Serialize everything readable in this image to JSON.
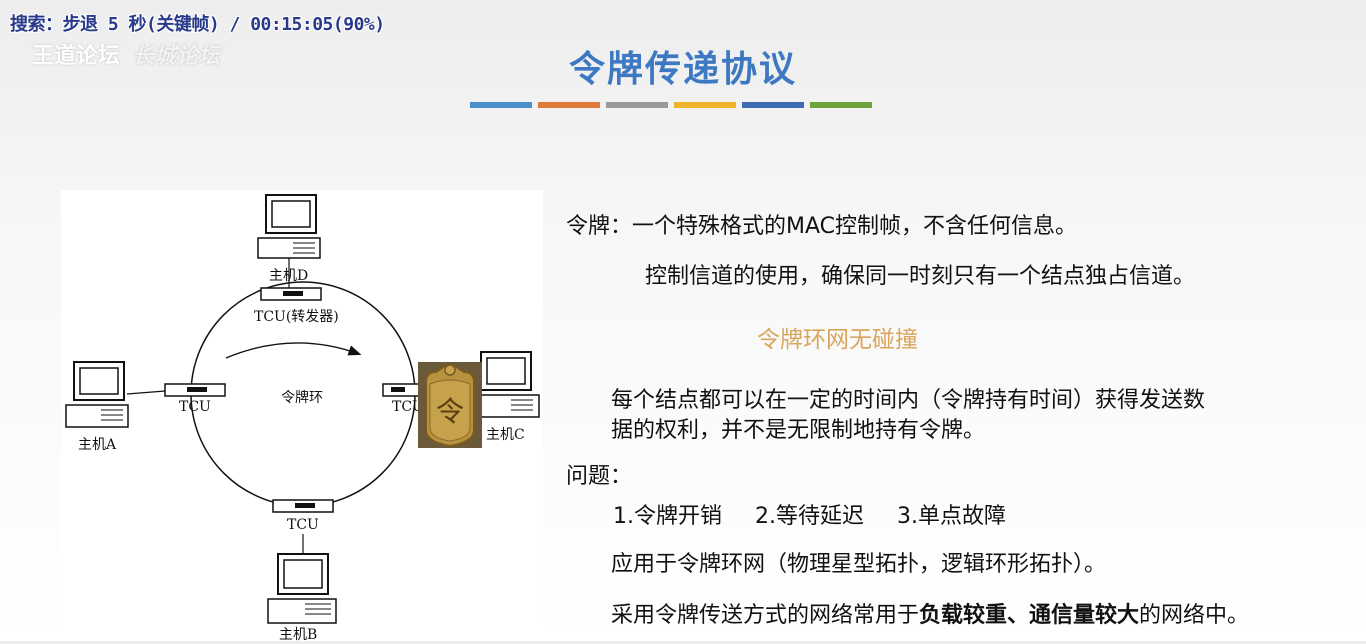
{
  "overlay": {
    "status_text": "搜索：步退 5 秒(关键帧) / 00:15:05(90%)"
  },
  "watermark": {
    "text": "王道论坛",
    "faint_text": "长城论坛"
  },
  "slide": {
    "title": "令牌传递协议",
    "title_color": "#3d78c2",
    "bar_colors": [
      "#4a8fc9",
      "#e07a3a",
      "#9a9a9a",
      "#f0b42a",
      "#3f6bb5",
      "#6ea33c"
    ]
  },
  "diagram": {
    "host_d": "主机D",
    "tcu_top": "TCU(转发器)",
    "host_a": "主机A",
    "tcu_left": "TCU",
    "ring": "令牌环",
    "tcu_right": "TCU",
    "host_c": "主机C",
    "tcu_bottom": "TCU",
    "host_b": "主机B",
    "token_char": "令"
  },
  "content": {
    "line1": "令牌：一个特殊格式的MAC控制帧，不含任何信息。",
    "line2": "控制信道的使用，确保同一时刻只有一个结点独占信道。",
    "highlight": "令牌环网无碰撞",
    "para1_line1": "每个结点都可以在一定的时间内（令牌持有时间）获得发送数",
    "para1_line2": "据的权利，并不是无限制地持有令牌。",
    "problem_label": "问题：",
    "problems": [
      "1.令牌开销",
      "2.等待延迟",
      "3.单点故障"
    ],
    "application": "应用于令牌环网（物理星型拓扑，逻辑环形拓扑）。",
    "usage_prefix": "采用令牌传送方式的网络常用于",
    "usage_bold": "负载较重、通信量较大",
    "usage_suffix": "的网络中。"
  }
}
